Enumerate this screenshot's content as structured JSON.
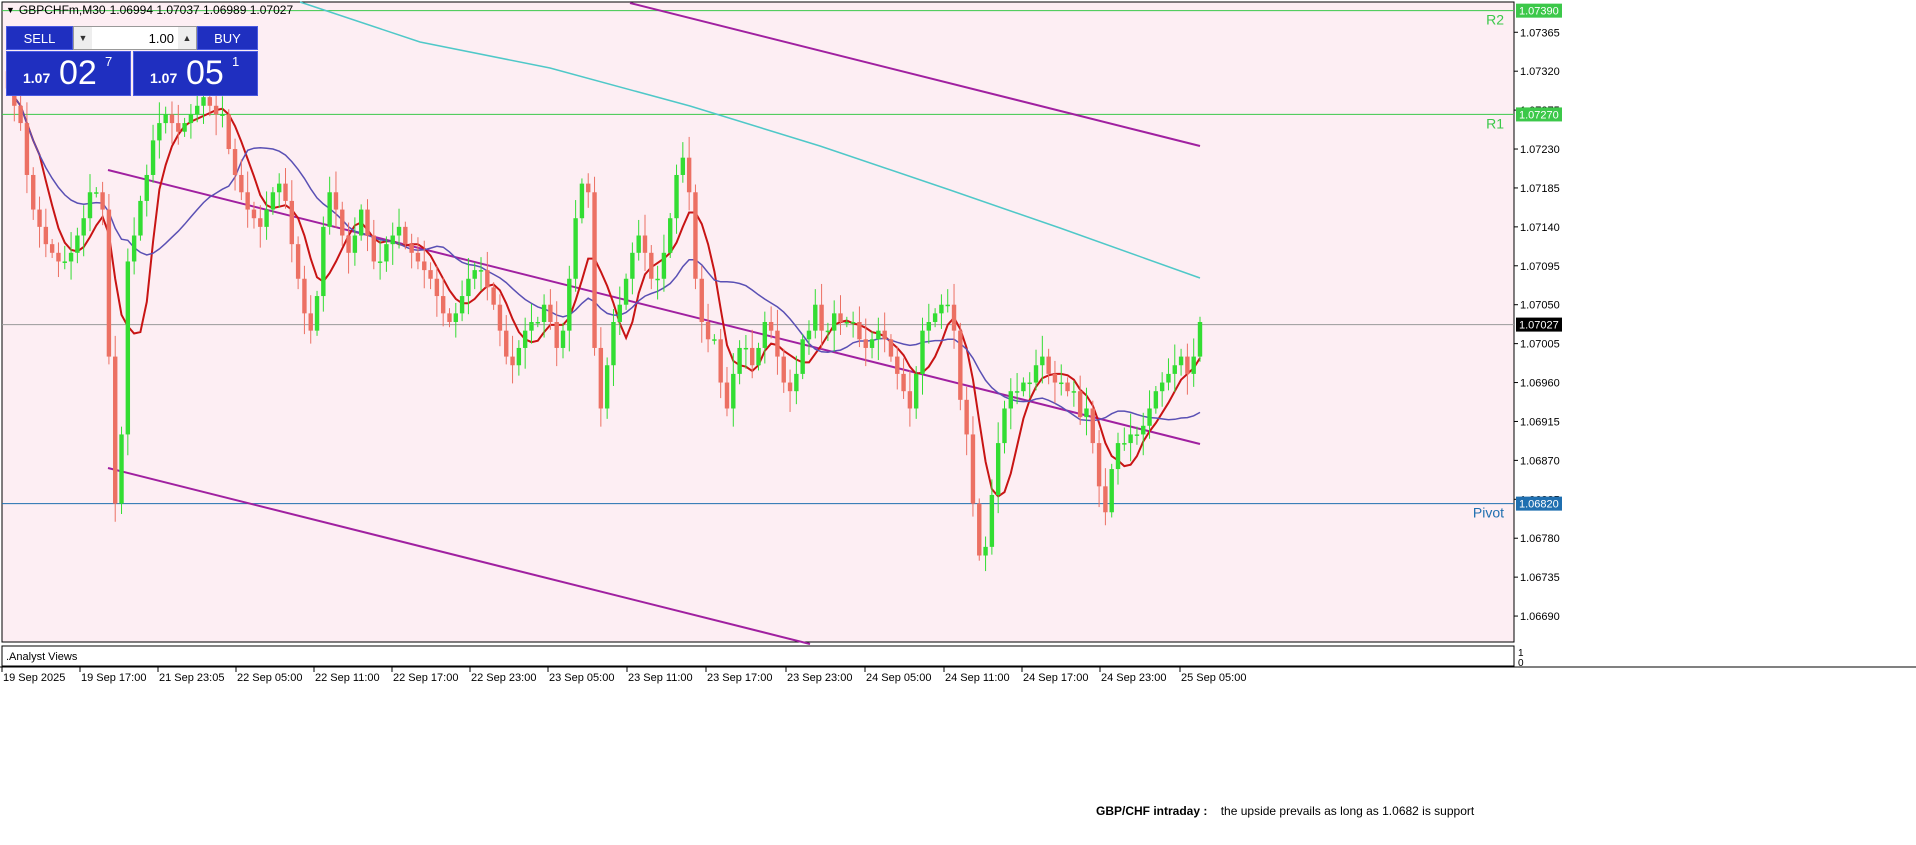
{
  "window": {
    "symbol_line": "GBPCHFm,M30",
    "ohlc": "1.06994 1.07037 1.06989 1.07027"
  },
  "trade_panel": {
    "sell_label": "SELL",
    "buy_label": "BUY",
    "lot_value": "1.00",
    "sell_prefix": "1.07",
    "sell_big": "02",
    "sell_sup": "7",
    "buy_prefix": "1.07",
    "buy_big": "05",
    "buy_sup": "1"
  },
  "subwindow": {
    "title": ".Analyst Views",
    "scale_top": "1",
    "scale_bottom": "0"
  },
  "news": {
    "label": "GBP/CHF intraday :",
    "text": "the upside prevails as long as 1.0682 is support"
  },
  "levels": [
    {
      "name": "R2",
      "price": "1.07390",
      "color": "#3cc84a"
    },
    {
      "name": "R1",
      "price": "1.07270",
      "color": "#3cc84a"
    },
    {
      "name": "Pivot",
      "price": "1.06820",
      "color": "#1f6fb0"
    }
  ],
  "current_price": "1.07027",
  "colors": {
    "background": "#fdeef3",
    "bull": "#33dd33",
    "bear": "#ec7063",
    "ma_fast": "#c81414",
    "ma_mid": "#5a50b4",
    "ma_slow": "#4fc8c8",
    "channel": "#a020a0"
  },
  "chart_data": {
    "type": "candlestick",
    "symbol": "GBPCHFm",
    "timeframe": "M30",
    "y_ticks": [
      "1.07365",
      "1.07320",
      "1.07275",
      "1.07230",
      "1.07185",
      "1.07140",
      "1.07095",
      "1.07050",
      "1.07005",
      "1.06960",
      "1.06915",
      "1.06870",
      "1.06825",
      "1.06780",
      "1.06735",
      "1.06690"
    ],
    "ylim": [
      1.0666,
      1.074
    ],
    "x_ticks": [
      "19 Sep 2025",
      "19 Sep 17:00",
      "21 Sep 23:05",
      "22 Sep 05:00",
      "22 Sep 11:00",
      "22 Sep 17:00",
      "22 Sep 23:00",
      "23 Sep 05:00",
      "23 Sep 11:00",
      "23 Sep 17:00",
      "23 Sep 23:00",
      "24 Sep 05:00",
      "24 Sep 11:00",
      "24 Sep 17:00",
      "24 Sep 23:00",
      "25 Sep 05:00"
    ],
    "close_path": [
      1.073,
      1.0728,
      1.0726,
      1.072,
      1.0716,
      1.0714,
      1.0712,
      1.0711,
      1.071,
      1.071,
      1.0711,
      1.0713,
      1.0715,
      1.0718,
      1.0718,
      1.0716,
      1.0699,
      1.0682,
      1.069,
      1.071,
      1.0713,
      1.0717,
      1.072,
      1.0724,
      1.0726,
      1.0727,
      1.0726,
      1.0725,
      1.0726,
      1.0727,
      1.0728,
      1.0729,
      1.0728,
      1.0727,
      1.0727,
      1.0723,
      1.072,
      1.0718,
      1.0716,
      1.0715,
      1.0714,
      1.0716,
      1.0718,
      1.0719,
      1.0717,
      1.0712,
      1.0708,
      1.0704,
      1.0702,
      1.0706,
      1.0714,
      1.0718,
      1.0716,
      1.0713,
      1.0711,
      1.0713,
      1.0716,
      1.0713,
      1.071,
      1.071,
      1.0712,
      1.0713,
      1.0714,
      1.0712,
      1.0711,
      1.071,
      1.0709,
      1.0708,
      1.0706,
      1.0704,
      1.0703,
      1.0704,
      1.0706,
      1.0708,
      1.0709,
      1.0709,
      1.0707,
      1.0705,
      1.0702,
      1.0699,
      1.0698,
      1.07,
      1.0702,
      1.0703,
      1.0703,
      1.0705,
      1.0703,
      1.07,
      1.0702,
      1.0708,
      1.0715,
      1.0719,
      1.0718,
      1.07,
      1.0693,
      1.0698,
      1.0703,
      1.0705,
      1.0708,
      1.0711,
      1.0713,
      1.0711,
      1.0708,
      1.0708,
      1.0711,
      1.0715,
      1.072,
      1.0722,
      1.0718,
      1.0708,
      1.0703,
      1.0701,
      1.0701,
      1.0696,
      1.0693,
      1.0697,
      1.07,
      1.07,
      1.0698,
      1.07,
      1.0703,
      1.0702,
      1.0699,
      1.0696,
      1.0695,
      1.0697,
      1.0701,
      1.0702,
      1.0705,
      1.0702,
      1.0702,
      1.0704,
      1.0703,
      1.0703,
      1.0703,
      1.0701,
      1.07,
      1.0701,
      1.0702,
      1.0701,
      1.0699,
      1.0697,
      1.0695,
      1.0693,
      1.0697,
      1.0702,
      1.0703,
      1.0704,
      1.0705,
      1.0705,
      1.0702,
      1.0694,
      1.069,
      1.0682,
      1.0676,
      1.0677,
      1.0683,
      1.0689,
      1.0693,
      1.0695,
      1.0695,
      1.0696,
      1.0696,
      1.0698,
      1.0699,
      1.0697,
      1.0696,
      1.0696,
      1.0695,
      1.0695,
      1.0692,
      1.0693,
      1.0689,
      1.0684,
      1.0681,
      1.0686,
      1.0689,
      1.0689,
      1.069,
      1.069,
      1.0691,
      1.0693,
      1.0695,
      1.0696,
      1.0697,
      1.0698,
      1.0699,
      1.0697,
      1.0699,
      1.0703
    ]
  }
}
